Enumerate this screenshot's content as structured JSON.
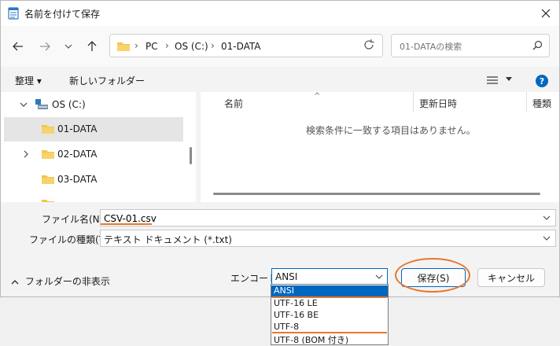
{
  "window": {
    "title": "名前を付けて保存"
  },
  "address": {
    "crumbs": [
      "PC",
      "OS (C:)",
      "01-DATA"
    ]
  },
  "search": {
    "placeholder": "01-DATAの検索"
  },
  "toolbar": {
    "organize": "整理 ▾",
    "new_folder": "新しいフォルダー"
  },
  "tree": [
    {
      "label": "OS (C:)",
      "icon": "drive-icon",
      "expanded": true
    },
    {
      "label": "01-DATA",
      "icon": "folder-icon",
      "selected": true
    },
    {
      "label": "02-DATA",
      "icon": "folder-icon"
    },
    {
      "label": "03-DATA",
      "icon": "folder-icon"
    }
  ],
  "columns": {
    "name": "名前",
    "date": "更新日時",
    "type": "種類"
  },
  "empty_message": "検索条件に一致する項目はありません。",
  "filename": {
    "label": "ファイル名(N):",
    "value": "CSV-01.csv"
  },
  "filetype": {
    "label": "ファイルの種類(T):",
    "value": "テキスト ドキュメント (*.txt)"
  },
  "hide_folders": "フォルダーの非表示",
  "encoding": {
    "label": "エンコード:",
    "value": "ANSI",
    "options": [
      "ANSI",
      "UTF-16 LE",
      "UTF-16 BE",
      "UTF-8",
      "UTF-8 (BOM 付き)"
    ]
  },
  "buttons": {
    "save": "保存(S)",
    "cancel": "キャンセル"
  },
  "colors": {
    "accent": "#0067c0",
    "annotation": "#e8772a",
    "folder": "#f4c44e"
  }
}
